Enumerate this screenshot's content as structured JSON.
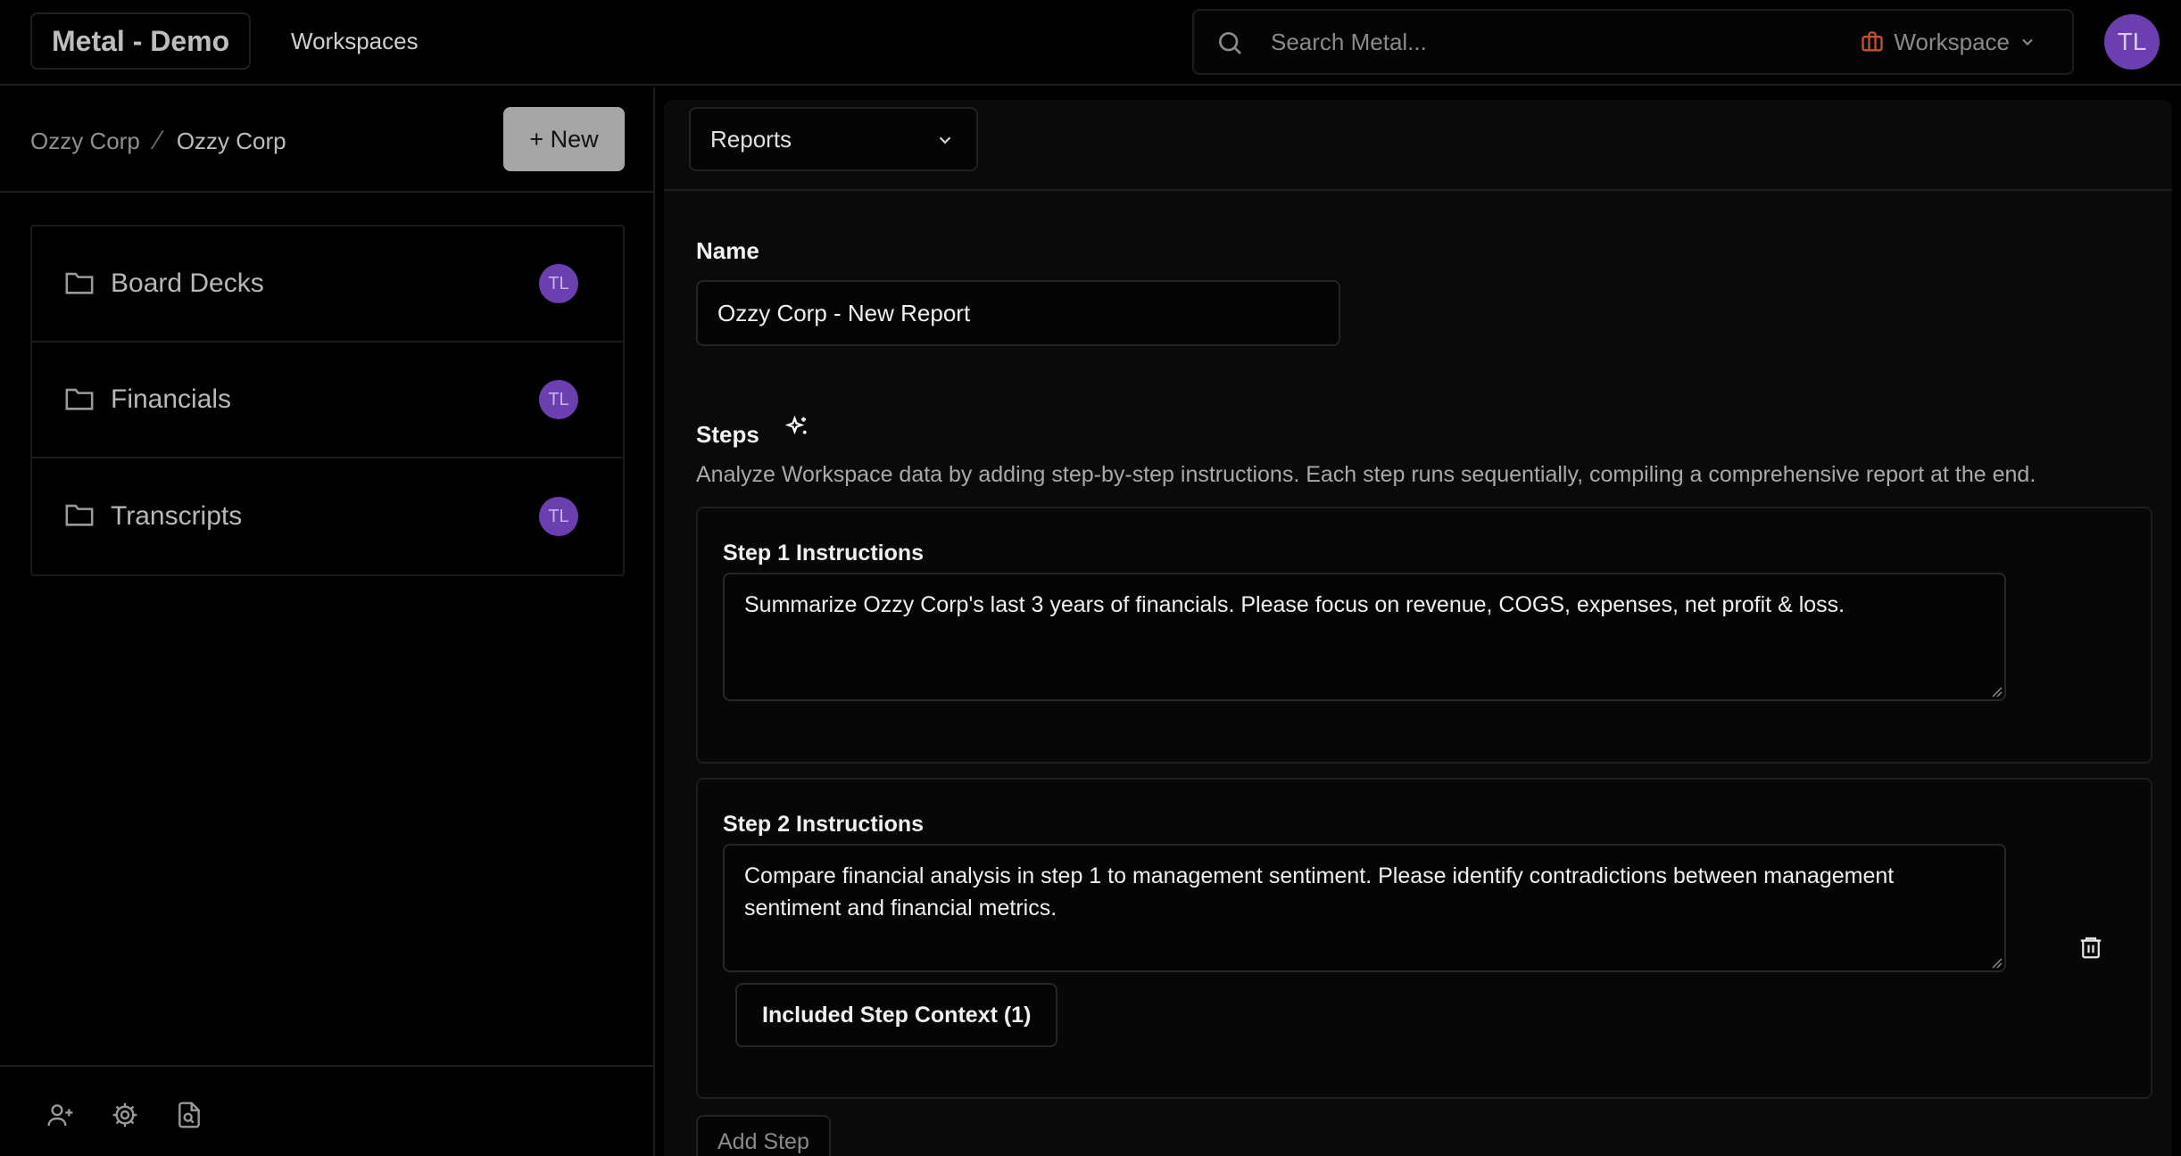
{
  "header": {
    "brand": "Metal - Demo",
    "nav_workspaces": "Workspaces",
    "search_placeholder": "Search Metal...",
    "workspace_label": "Workspace",
    "user_initials": "TL"
  },
  "sidebar": {
    "breadcrumb": [
      "Ozzy Corp",
      "Ozzy Corp"
    ],
    "new_button": "+ New",
    "folders": [
      {
        "label": "Board Decks",
        "owner": "TL"
      },
      {
        "label": "Financials",
        "owner": "TL"
      },
      {
        "label": "Transcripts",
        "owner": "TL"
      }
    ],
    "bottom_icons": [
      "add-user-icon",
      "settings-icon",
      "document-search-icon"
    ]
  },
  "main": {
    "type_select": "Reports",
    "name_label": "Name",
    "name_value": "Ozzy Corp - New Report",
    "steps_label": "Steps",
    "steps_description": "Analyze Workspace data by adding step-by-step instructions. Each step runs sequentially, compiling a comprehensive report at the end.",
    "steps": [
      {
        "title": "Step 1 Instructions",
        "text": "Summarize Ozzy Corp's last 3 years of financials. Please focus on revenue, COGS, expenses, net profit & loss."
      },
      {
        "title": "Step 2 Instructions",
        "text": "Compare financial analysis in step 1 to management sentiment. Please identify contradictions between management sentiment and financial metrics.",
        "context_button": "Included Step Context (1)"
      }
    ],
    "add_step": "Add Step"
  },
  "colors": {
    "background": "#000000",
    "panel": "#0a0a0b",
    "avatar": "#6b3fb0",
    "workspace_icon": "#c0552b"
  }
}
